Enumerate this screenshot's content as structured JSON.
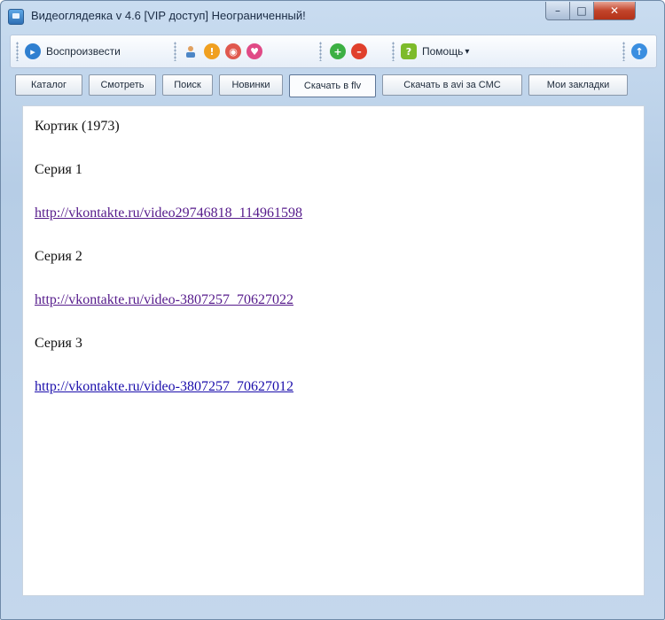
{
  "window": {
    "title": "Видеоглядеяка v 4.6 [VIP доступ] Неограниченный!",
    "controls": {
      "minimize": "–",
      "maximize": "□",
      "close": "✕"
    }
  },
  "toolbar": {
    "play_label": "Воспроизвести",
    "help_label": "Помощь",
    "help_arrow": "▾",
    "icons": [
      "play-icon",
      "user-icon",
      "warning-icon",
      "eye-icon",
      "heart-icon",
      "add-icon",
      "remove-icon",
      "help-icon",
      "up-arrow-icon"
    ]
  },
  "tabs": [
    {
      "label": "Каталог"
    },
    {
      "label": "Смотреть"
    },
    {
      "label": "Поиск"
    },
    {
      "label": "Новинки"
    },
    {
      "label": "Скачать в flv",
      "active": true
    },
    {
      "label": "Скачать в avi за СМС"
    },
    {
      "label": "Мои закладки"
    }
  ],
  "content": {
    "movie_title": "Кортик (1973)",
    "episodes": [
      {
        "label": "Серия 1",
        "url": "http://vkontakte.ru/video29746818_114961598",
        "visited": true
      },
      {
        "label": "Серия 2",
        "url": "http://vkontakte.ru/video-3807257_70627022",
        "visited": true
      },
      {
        "label": "Серия 3",
        "url": "http://vkontakte.ru/video-3807257_70627012",
        "visited": false
      }
    ]
  },
  "colors": {
    "link": "#1a0dab",
    "visited_link": "#551a8b",
    "close_button": "#c2442b"
  }
}
